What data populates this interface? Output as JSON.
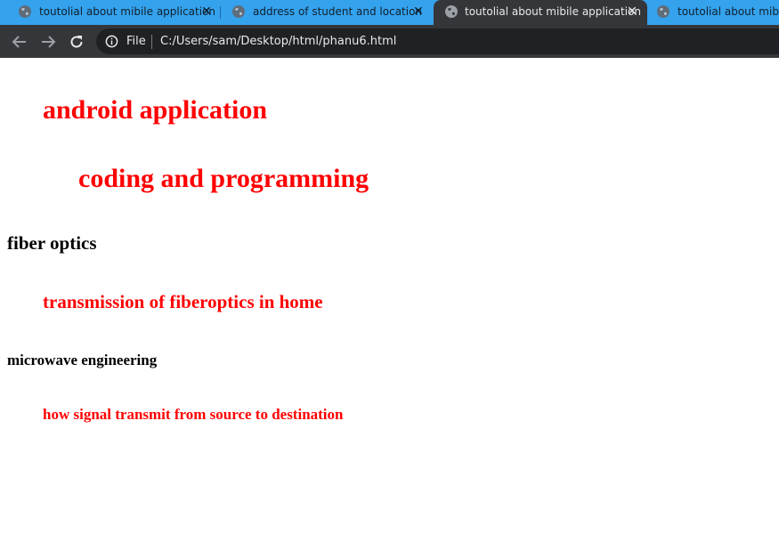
{
  "browser": {
    "tabs": [
      {
        "title": "toutolial about mibile application",
        "active": false,
        "favicon": "globe-icon"
      },
      {
        "title": "address of student and location",
        "active": false,
        "favicon": "globe-icon"
      },
      {
        "title": "toutolial about mibile application",
        "active": true,
        "favicon": "globe-icon"
      },
      {
        "title": "toutolial about mibile application",
        "active": false,
        "favicon": "globe-icon"
      }
    ],
    "close_glyph": "✕",
    "colors": {
      "tab_strip": "#35a2ed",
      "active_tab": "#35363a",
      "toolbar": "#35363a",
      "omnibox": "#202124"
    },
    "address": {
      "scheme_label": "File",
      "url": "C:/Users/sam/Desktop/html/phanu6.html",
      "icon": "info-icon"
    },
    "nav_icons": [
      "back-arrow-icon",
      "forward-arrow-icon",
      "reload-icon"
    ]
  },
  "page": {
    "lines": [
      {
        "text": "android application",
        "color": "#ff0000"
      },
      {
        "text": "coding and programming",
        "color": "#ff0000"
      },
      {
        "text": "fiber optics",
        "color": "#000000"
      },
      {
        "text": "transmission of fiberoptics in home",
        "color": "#ff0000"
      },
      {
        "text": "microwave engineering",
        "color": "#000000"
      },
      {
        "text": "how signal transmit from source to destination",
        "color": "#ff0000"
      }
    ]
  }
}
